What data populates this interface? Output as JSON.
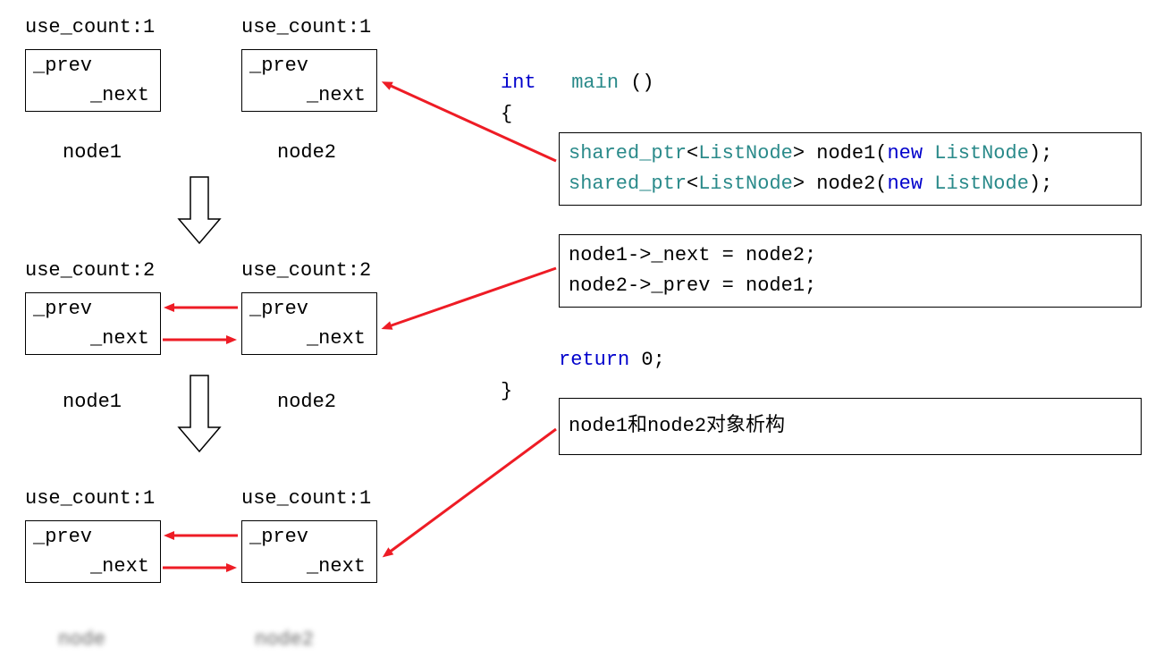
{
  "stage1": {
    "node1": {
      "use_count": "use_count:1",
      "prev": "_prev",
      "next": "_next",
      "label": "node1"
    },
    "node2": {
      "use_count": "use_count:1",
      "prev": "_prev",
      "next": "_next",
      "label": "node2"
    }
  },
  "stage2": {
    "node1": {
      "use_count": "use_count:2",
      "prev": "_prev",
      "next": "_next",
      "label": "node1"
    },
    "node2": {
      "use_count": "use_count:2",
      "prev": "_prev",
      "next": "_next",
      "label": "node2"
    }
  },
  "stage3": {
    "node1": {
      "use_count": "use_count:1",
      "prev": "_prev",
      "next": "_next"
    },
    "node2": {
      "use_count": "use_count:1",
      "prev": "_prev",
      "next": "_next"
    }
  },
  "code": {
    "fn_kw": "int",
    "fn_name": "main",
    "fn_parens": "()",
    "brace_open": "{",
    "brace_close": "}",
    "line1_t1": "shared_ptr",
    "line1_angle_open": "<",
    "line1_t2": "ListNode",
    "line1_angle_close": ">",
    "line1_var": " node1",
    "line1_paren_open": "(",
    "line1_new": "new",
    "line1_t3": " ListNode",
    "line1_paren_close": ")",
    "line1_semi": ";",
    "line2_t1": "shared_ptr",
    "line2_angle_open": "<",
    "line2_t2": "ListNode",
    "line2_angle_close": ">",
    "line2_var": " node2",
    "line2_paren_open": "(",
    "line2_new": "new",
    "line2_t3": " ListNode",
    "line2_paren_close": ")",
    "line2_semi": ";",
    "box2_line1": "node1->_next = node2;",
    "box2_line2": "node2->_prev = node1;",
    "return_kw": "return",
    "return_val": " 0",
    "return_semi": ";",
    "box3_text": "node1和node2对象析构"
  },
  "blurred": {
    "a": "node",
    "b": "node2"
  }
}
